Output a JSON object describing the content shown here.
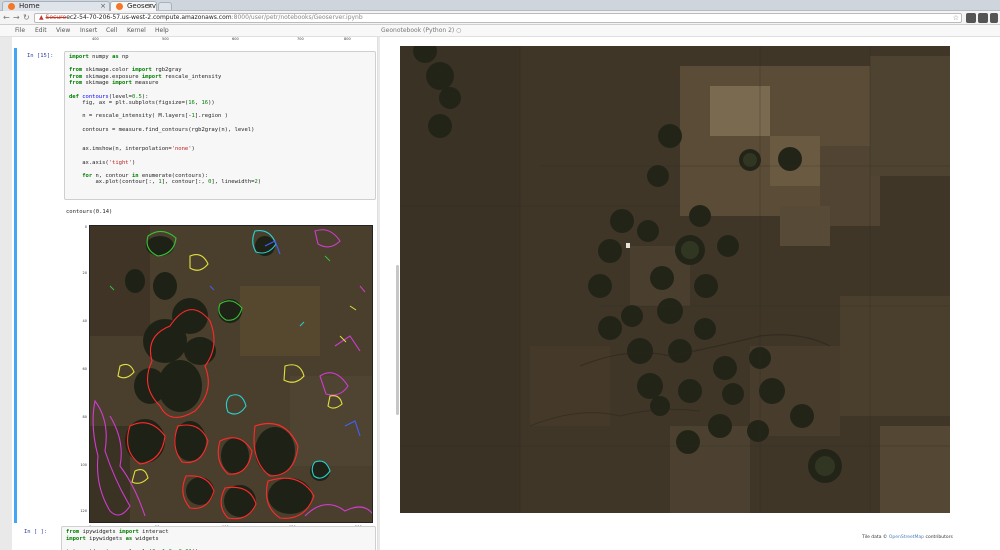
{
  "browser": {
    "tabs": [
      {
        "label": "Home"
      },
      {
        "label": "Geoserver"
      }
    ],
    "address": {
      "security_label": "Secure",
      "host": "ec2-54-70-206-57.us-west-2.compute.amazonaws.com",
      "path": ":8000/user/petr/notebooks/Geoserver.ipynb"
    }
  },
  "menubar": {
    "items": [
      "File",
      "Edit",
      "View",
      "Insert",
      "Cell",
      "Kernel",
      "Help"
    ],
    "kernel_label": "Geonotebook (Python 2)"
  },
  "notebook": {
    "top_ticks": [
      "400",
      "500",
      "600",
      "700",
      "800"
    ],
    "cell1": {
      "prompt": "In [15]:",
      "code_lines": [
        "import numpy as np",
        "",
        "from skimage.color import rgb2gray",
        "from skimage.exposure import rescale_intensity",
        "from skimage import measure",
        "",
        "def contours(level=0.5):",
        "    fig, ax = plt.subplots(figsize=(16, 16))",
        "",
        "    n = rescale_intensity( M.layers[-1].region )",
        "",
        "    contours = measure.find_contours(rgb2gray(n), level)",
        "",
        "",
        "    ax.imshow(n, interpolation='none')",
        "",
        "    ax.axis('tight')",
        "",
        "    for n, contour in enumerate(contours):",
        "        ax.plot(contour[:, 1], contour[:, 0], linewidth=2)"
      ],
      "output_call": "contours(0.14)"
    },
    "plot": {
      "yticks": [
        "0",
        "20",
        "40",
        "60",
        "80",
        "100",
        "120"
      ],
      "xticks": [
        "0",
        "50",
        "100",
        "150",
        "200"
      ]
    },
    "cell2": {
      "prompt": "In [ ]:",
      "code_lines": [
        "from ipywidgets import interact",
        "import ipywidgets as widgets",
        "",
        "interact(contours, level=(0, 1.0, 0.01))"
      ]
    }
  },
  "map": {
    "attribution_prefix": "Tile data ©",
    "attribution_link": "OpenStreetMap",
    "attribution_suffix": "contributors"
  },
  "colors": {
    "accent": "#42a5f5",
    "contour_red": "#ff2a2a",
    "contour_magenta": "#d03cd0",
    "contour_cyan": "#2ad0d0",
    "contour_green": "#38c038",
    "contour_yellow": "#e0e040"
  }
}
